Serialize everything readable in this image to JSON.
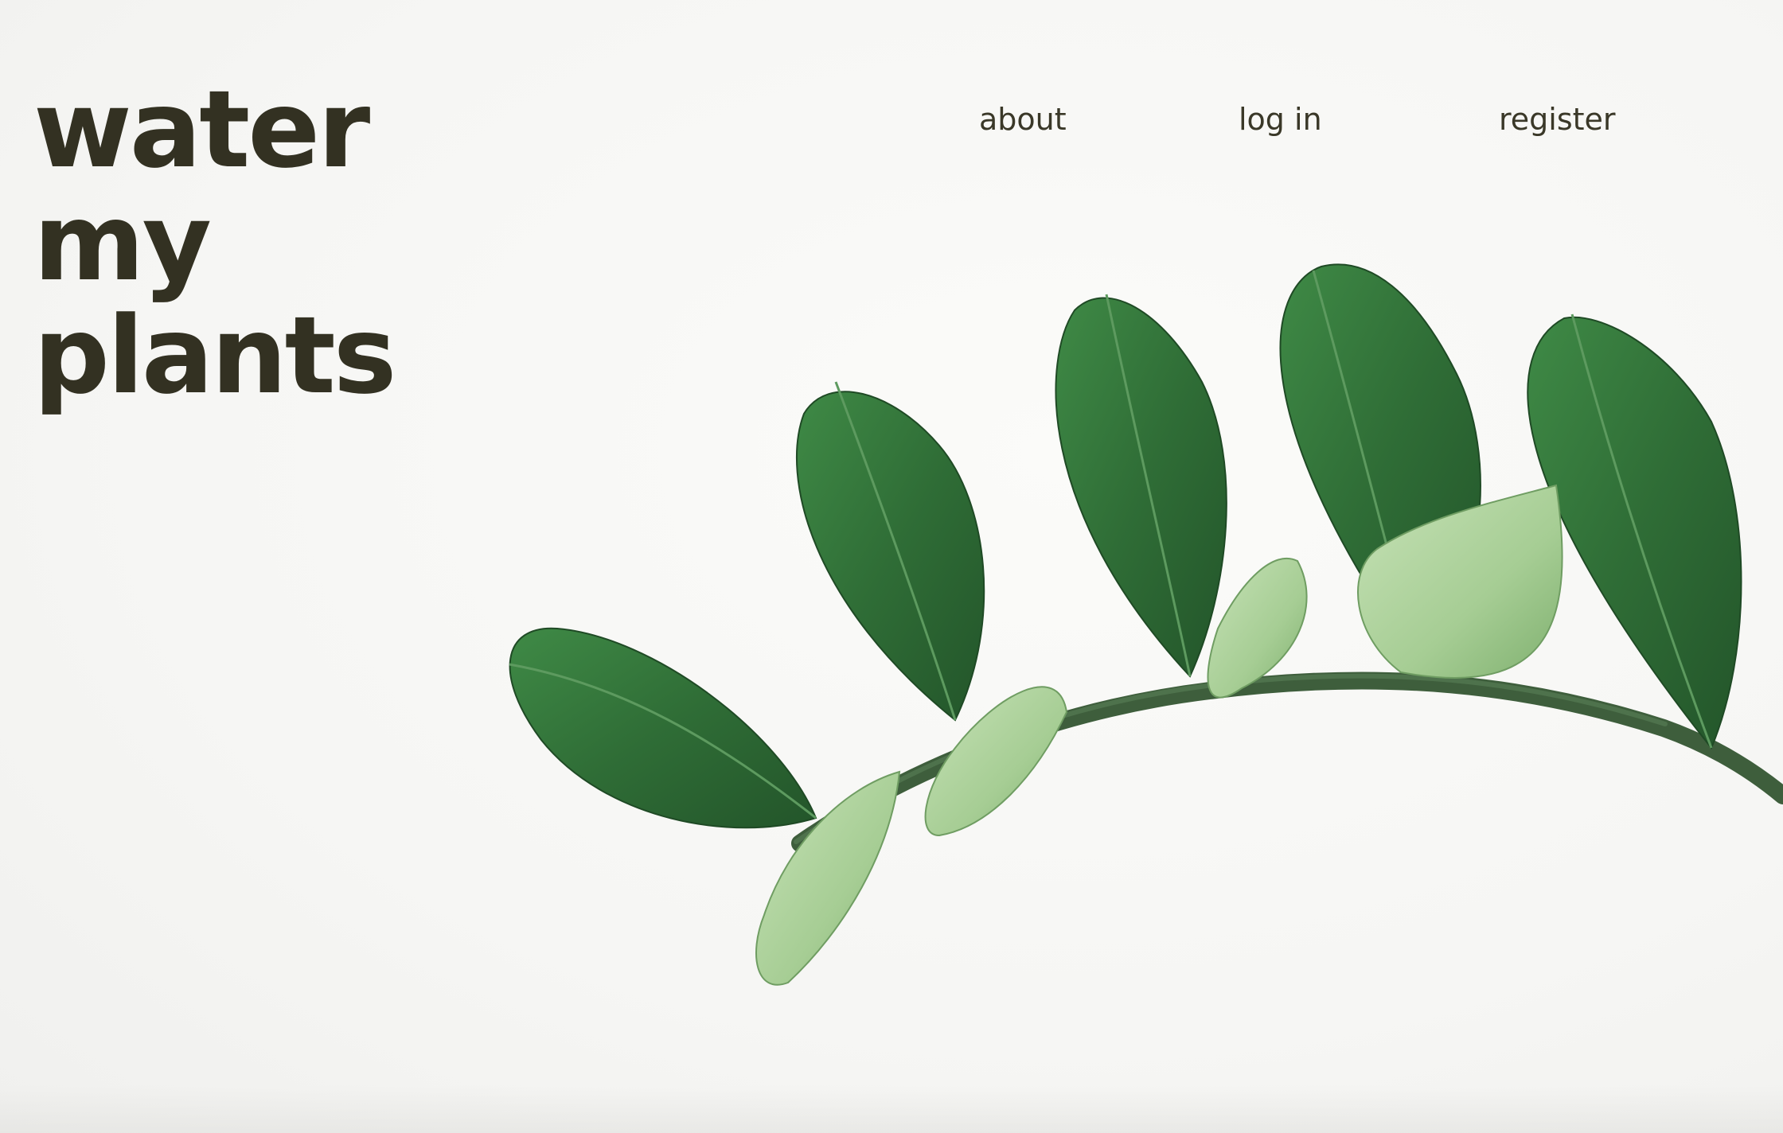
{
  "brand": {
    "line1": "water",
    "line2": "my",
    "line3": "plants"
  },
  "nav": {
    "items": [
      {
        "label": "about"
      },
      {
        "label": "log in"
      },
      {
        "label": "register"
      }
    ]
  },
  "colors": {
    "background": "#f7f7f5",
    "text": "#333122",
    "leaf_dark": "#2f6b37",
    "leaf_light": "#a7cf95"
  },
  "hero_image": {
    "icon": "plant-branch-icon"
  }
}
